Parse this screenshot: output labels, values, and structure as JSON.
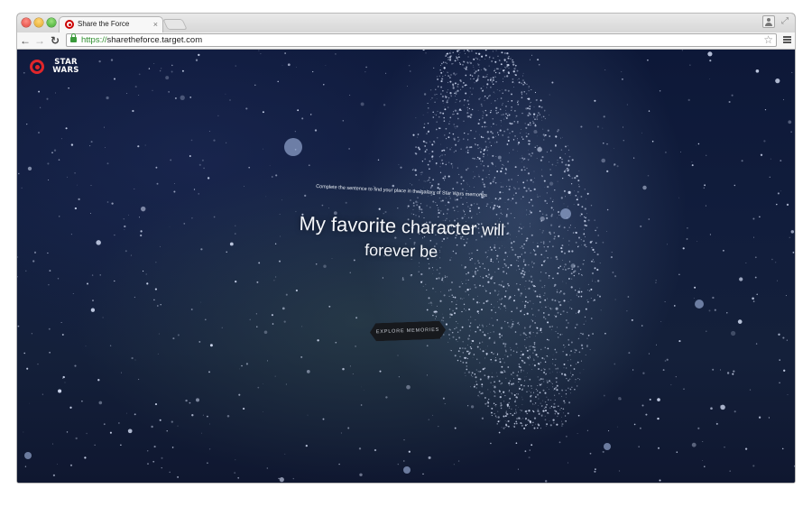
{
  "browser": {
    "tab_title": "Share the Force",
    "tab_close": "×",
    "url_scheme": "https://",
    "url_host": "sharetheforce.target.com"
  },
  "page": {
    "logo_text_line1": "STAR",
    "logo_text_line2": "WARS",
    "prompt": "Complete the sentence to find your place in the galaxy of Star Wars memories",
    "headline": {
      "w1": "My favorite",
      "w2": "character",
      "w3": "will",
      "w4": "forever be"
    },
    "cta_label": "EXPLORE MEMORIES"
  },
  "icons": [
    "target-logo-icon",
    "star-wars-logo-icon",
    "lock-icon",
    "bookmark-star-icon",
    "menu-icon",
    "back-icon",
    "forward-icon",
    "reload-icon",
    "profile-icon",
    "fullscreen-icon"
  ],
  "colors": {
    "target_red": "#e0262b",
    "space_dark": "#0d1838",
    "secure_green": "#2f8f2f"
  }
}
